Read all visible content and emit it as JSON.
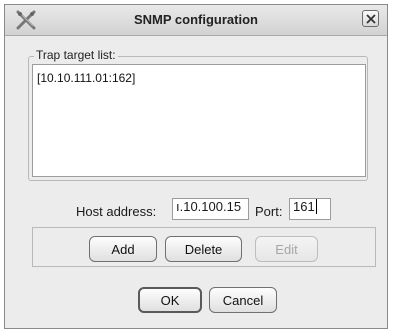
{
  "dialog": {
    "title": "SNMP configuration"
  },
  "trap_target": {
    "legend": "Trap target list:",
    "items": [
      "[10.10.111.01:162]"
    ]
  },
  "host": {
    "label": "Host address:",
    "value": "1.10.100.15",
    "visible_text": "ı.10.100.15",
    "port_label": "Port:",
    "port_value": "161"
  },
  "buttons": {
    "add": "Add",
    "delete": "Delete",
    "edit": "Edit",
    "ok": "OK",
    "cancel": "Cancel"
  },
  "icons": {
    "app": "x-tool-icon",
    "close": "close-icon"
  }
}
